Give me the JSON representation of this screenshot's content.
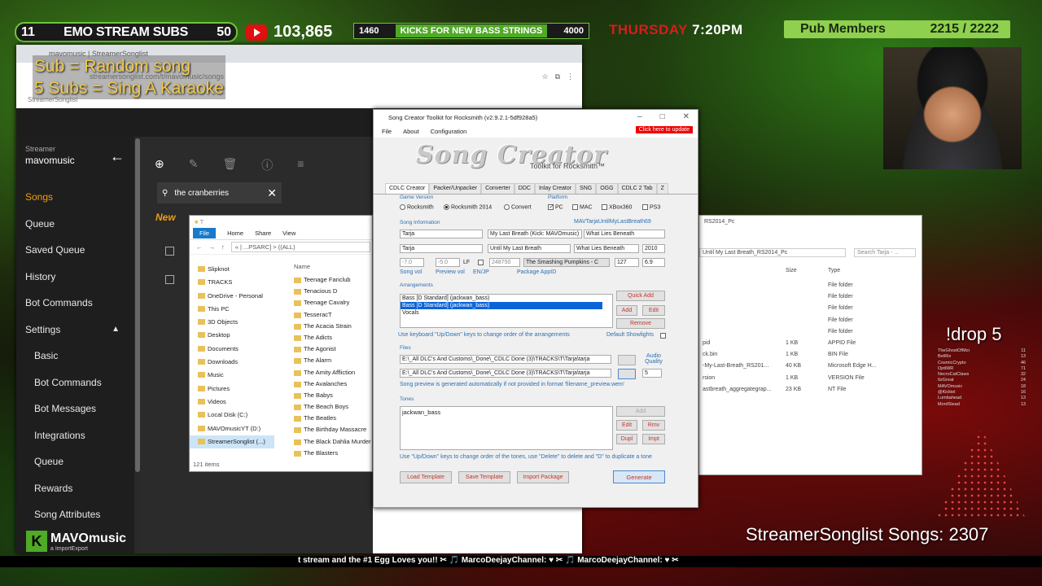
{
  "stream": {
    "subs_left": "11",
    "subs_title": "EMO STREAM SUBS",
    "subs_right": "50",
    "yt_count": "103,865",
    "kicks_left": "1460",
    "kicks_mid": "KICKS FOR NEW BASS STRINGS",
    "kicks_right": "4000",
    "day": "THURSDAY",
    "time": "7:20PM",
    "pub_label": "Pub Members",
    "pub_count": "2215 / 2222",
    "overlay_line1": "Sub = Random song",
    "overlay_line2": "5 Subs = Sing A Karaoke",
    "drop": "!drop 5",
    "songcount": "StreamerSonglist Songs: 2307",
    "ticker": "t stream and the #1 Egg Loves you!! ✂ 🎵 MarcoDeejayChannel: ♥ ✂ 🎵 MarcoDeejayChannel: ♥ ✂ ",
    "logo": "MAVOmusic",
    "logo_sub": "a ImportExport",
    "leaderboard": [
      [
        "TheGhostOfMoi",
        "11"
      ],
      [
        "BetRix",
        "13"
      ],
      [
        "CosmicCrypto",
        "46"
      ],
      [
        "OptiWR",
        "71"
      ],
      [
        "NecroCatClaws",
        "32"
      ],
      [
        "ItzGreat",
        "24"
      ],
      [
        "MAVOmusic",
        "18"
      ],
      [
        "@Kickiel",
        "16"
      ],
      [
        "Lumbahead",
        "13"
      ],
      [
        "MordStead",
        "13"
      ]
    ]
  },
  "browser": {
    "tab": "mavomusic | StreamerSonglist",
    "url": "streamersonglist.com/t/mavomusic/songs",
    "bookmark": "StreamerSonglist"
  },
  "sidebar": {
    "streamer_label": "Streamer",
    "streamer_name": "mavomusic",
    "items": [
      "Songs",
      "Queue",
      "Saved Queue",
      "History",
      "Bot Commands",
      "Settings"
    ],
    "sub_items": [
      "Basic",
      "Bot Commands",
      "Bot Messages",
      "Integrations",
      "Queue",
      "Rewards",
      "Song Attributes"
    ]
  },
  "main": {
    "search_value": "the cranberries",
    "new_label": "New"
  },
  "explorer": {
    "title": "T",
    "ribbon": [
      "File",
      "Home",
      "Share",
      "View"
    ],
    "path": "« | ...PSARC] > ((ALL)",
    "tree": [
      "Slipknot",
      "TRACKS",
      "OneDrive - Personal",
      "This PC",
      "3D Objects",
      "Desktop",
      "Documents",
      "Downloads",
      "Music",
      "Pictures",
      "Videos",
      "Local Disk (C:)",
      "MAVOmusicYT (D:)",
      "StreamerSonglist (...)"
    ],
    "col_name": "Name",
    "files": [
      "Teenage Fanclub",
      "Tenacious D",
      "Teenage Cavalry",
      "TesseracT",
      "The Acacia Strain",
      "The Adicts",
      "The Agonist",
      "The Alarm",
      "The Amity Affliction",
      "The Avalanches",
      "The Babys",
      "The Beach Boys",
      "The Beatles",
      "The Birthday Massacre",
      "The Black Dahlia Murder",
      "The Blasters"
    ],
    "status": "121 items"
  },
  "sct": {
    "title": "Song Creator Toolkit for Rocksmith (v2.9.2.1-5df928a5)",
    "menu": [
      "File",
      "About",
      "Configuration"
    ],
    "update": "Click here to update",
    "logo": "Song Creator",
    "logo_sub": "Toolkit for Rocksmith™",
    "tabs": [
      "CDLC Creator",
      "Packer/Unpacker",
      "Converter",
      "DDC",
      "Inlay Creator",
      "SNG",
      "OGG",
      "CDLC 2 Tab",
      "Z"
    ],
    "game_version": "Game Version",
    "gv_options": [
      "Rocksmith",
      "Rocksmith 2014",
      "Convert"
    ],
    "platform": "Platform",
    "platforms": [
      "PC",
      "MAC",
      "XBox360",
      "PS3"
    ],
    "song_info": "Song Information",
    "dlc_key": "MAVTarjaUntilMyLastBreath69",
    "artist": "Tarja",
    "artist_sort": "Tarja",
    "title_field": "My Last Breath (Kick: MAVOmusic)",
    "title_sort": "Until My Last Breath",
    "album": "What Lies Beneath",
    "album_sort": "What Lies Beneath",
    "year": "2010",
    "vol": "-7.0",
    "preview_vol": "-5.0",
    "lf_label": "LF",
    "app_id": "248750",
    "app_name": "The Smashing Pumpkins - C",
    "tempo": "127",
    "avg": "6.9",
    "song_vol": "Song vol",
    "preview_vol_lbl": "Preview vol",
    "en_jp": "EN/JP",
    "package_appid": "Package AppID",
    "arrangements": "Arrangements",
    "arr": [
      "Bass [D Standard] (jackwan_bass)",
      "Bass [D Standard] (jackwan_bass)",
      "Vocals"
    ],
    "quick_add": "Quick Add",
    "add": "Add",
    "edit": "Edit",
    "remove": "Remove",
    "arr_hint": "Use keyboard \"Up/Down\" keys to change order of the arrangements",
    "default_showlights": "Default Showlights",
    "files": "Files",
    "file1": "E:\\_All DLC's And Customs\\_Done\\_CDLC Done (3)\\TRACKS\\T\\Tarja\\tarja",
    "file2": "E:\\_All DLC's And Customs\\_Done\\_CDLC Done (3)\\TRACKS\\T\\Tarja\\tarja",
    "audio_quality": "Audio Quality",
    "quality": "5",
    "preview_hint": "Song preview is generated automatically if not provided in format 'filename_preview.wem'",
    "tones": "Tones",
    "tone": "jackwan_bass",
    "tone_btns": [
      "Add",
      "Edit",
      "Rmv",
      "Dupl",
      "Impt"
    ],
    "tone_hint": "Use \"Up/Down\" keys to change order of the tones, use \"Delete\" to delete and \"D\" to duplicate a tone",
    "load_template": "Load Template",
    "save_template": "Save Template",
    "import_package": "Import Package",
    "generate": "Generate"
  },
  "explorer2": {
    "path": "Until My Last Breath_RS2014_Pc",
    "search": "Search Tarja - ...",
    "title": "RS2014_Pc",
    "cols": [
      "Size",
      "Type"
    ],
    "rows": [
      [
        "",
        "",
        "File folder"
      ],
      [
        "",
        "",
        "File folder"
      ],
      [
        "",
        "",
        "File folder"
      ],
      [
        "",
        "",
        "File folder"
      ],
      [
        "",
        "",
        "File folder"
      ],
      [
        "pid",
        "1 KB",
        "APPID File"
      ],
      [
        "ck.bin",
        "1 KB",
        "BIN File"
      ],
      [
        "-My-Last-Breath_RS201...",
        "40 KB",
        "Microsoft Edge H..."
      ],
      [
        "rsion",
        "1 KB",
        "VERSION File"
      ],
      [
        "astbreath_aggregategrap...",
        "23 KB",
        "NT File"
      ]
    ]
  }
}
